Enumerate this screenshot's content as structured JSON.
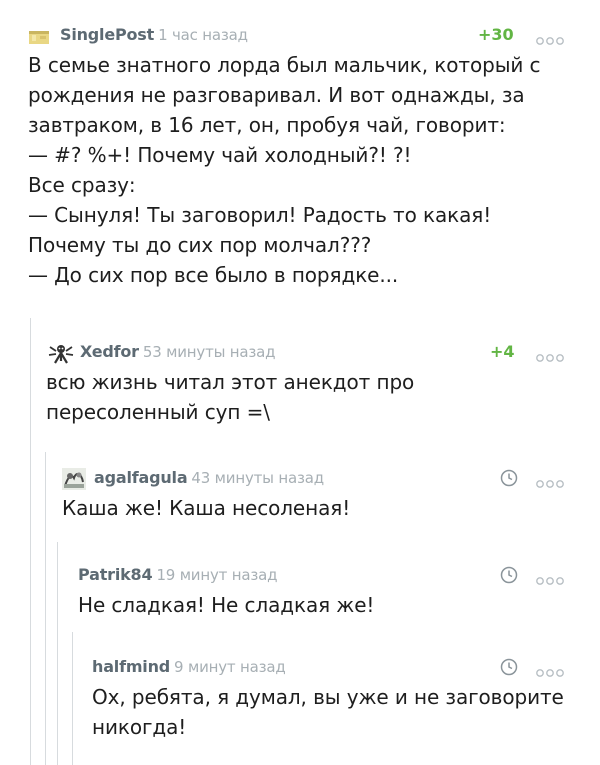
{
  "comments": [
    {
      "author": "SinglePost",
      "time": "1 час назад",
      "rating": "+30",
      "text": "В семье знатного лорда был мальчик, который с\nрождения не разговаривал. И вот однажды, за\nзавтраком, в 16 лет, он, пробуя чай, говорит:\n— #? %+! Почему чай холодный?! ?!\nВсе сразу:\n— Сынуля! Ты заговорил! Радость то какая!\nПочему ты до сих пор молчал???\n— До сих пор все было в порядке..."
    },
    {
      "author": "Xedfor",
      "time": "53 минуты назад",
      "rating": "+4",
      "text": "всю жизнь читал этот анекдот про\nпересоленный суп =\\"
    },
    {
      "author": "agalfagula",
      "time": "43 минуты назад",
      "text": "Каша же! Каша несоленая!"
    },
    {
      "author": "Patrik84",
      "time": "19 минут назад",
      "text": "Не сладкая! Не сладкая же!"
    },
    {
      "author": "halfmind",
      "time": "9 минут назад",
      "text": "Ох, ребята, я думал, вы уже и не заговорите\nникогда!"
    }
  ],
  "colors": {
    "author": "#5d6a73",
    "time": "#a7afb4",
    "rating_positive": "#62b544",
    "thread_line": "#d7dbde"
  },
  "icons": {
    "more": "more-dots-icon",
    "clock": "clock-icon"
  }
}
